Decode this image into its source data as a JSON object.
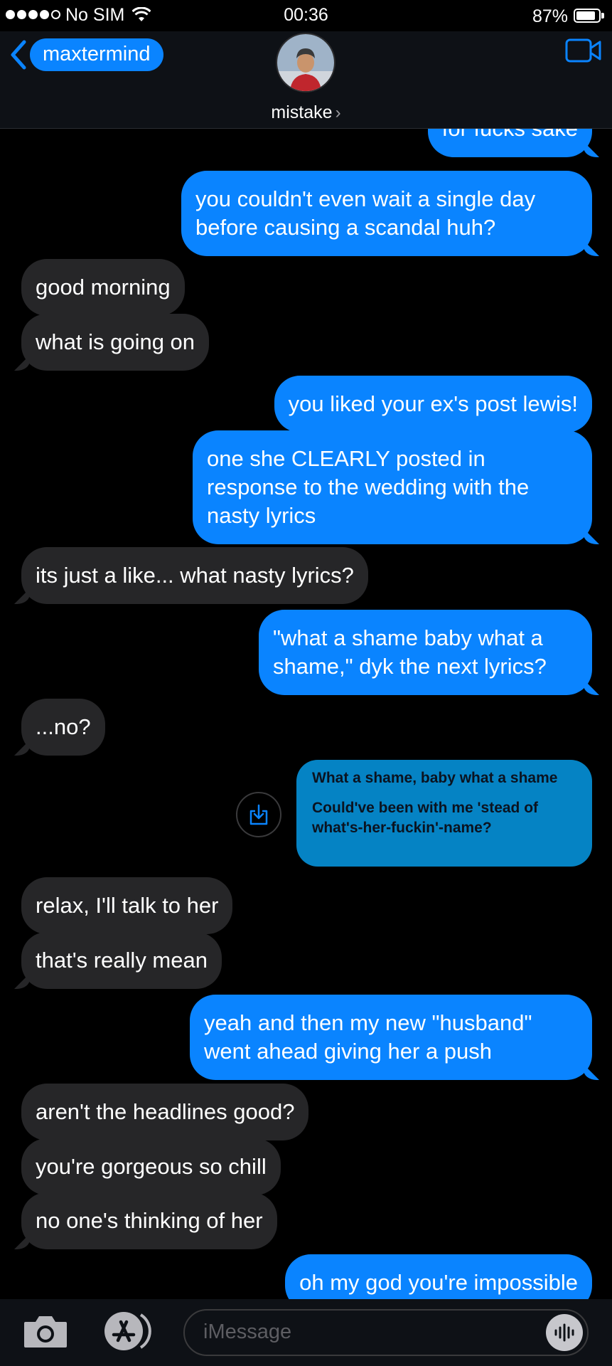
{
  "status_bar": {
    "carrier": "No SIM",
    "time": "00:36",
    "battery": "87%",
    "battery_level": 0.87,
    "signal_bars_filled": 4,
    "signal_bars_total": 5
  },
  "header": {
    "back_label": "maxtermind",
    "contact_name": "mistake",
    "contact_chevron": "›",
    "icons": {
      "back": "chevron-left-icon",
      "video": "video-camera-icon"
    },
    "accent_color": "#0a84ff"
  },
  "messages": [
    {
      "side": "out",
      "text": "for fucks sake"
    },
    {
      "side": "out",
      "text": "you couldn't even wait a single day\nbefore causing a scandal huh?"
    },
    {
      "side": "in",
      "text": "good morning"
    },
    {
      "side": "in",
      "text": "what is going on"
    },
    {
      "side": "out",
      "text": "you liked your ex's post lewis!"
    },
    {
      "side": "out",
      "text": "one she CLEARLY posted in\nresponse to the wedding with the\nnasty lyrics"
    },
    {
      "side": "in",
      "text": "its just a like... what nasty lyrics?"
    },
    {
      "side": "out",
      "text": "\"what a shame baby what a\nshame,\" dyk the next lyrics?"
    },
    {
      "side": "in",
      "text": "...no?"
    },
    {
      "side": "in",
      "text": "relax, I'll talk to her"
    },
    {
      "side": "in",
      "text": "that's really mean"
    },
    {
      "side": "out",
      "text": "yeah and then my new \"husband\"\nwent ahead giving her a push"
    },
    {
      "side": "in",
      "text": "aren't the headlines good?"
    },
    {
      "side": "in",
      "text": "you're gorgeous so chill"
    },
    {
      "side": "in",
      "text": "no one's thinking of her"
    },
    {
      "side": "out",
      "text": "oh my god you're impossible"
    }
  ],
  "lyrics_card": {
    "line1": "What a shame, baby what a shame",
    "line2": "Could've been with me 'stead of what's-her-fuckin'-name?",
    "save_icon": "download-icon",
    "card_color": "#0583c4"
  },
  "input_bar": {
    "placeholder": "iMessage",
    "icons": {
      "camera": "camera-icon",
      "apps": "app-store-icon",
      "audio": "audio-waveform-icon"
    }
  },
  "colors": {
    "outgoing": "#0a84ff",
    "incoming": "#262628",
    "background": "#000000"
  }
}
